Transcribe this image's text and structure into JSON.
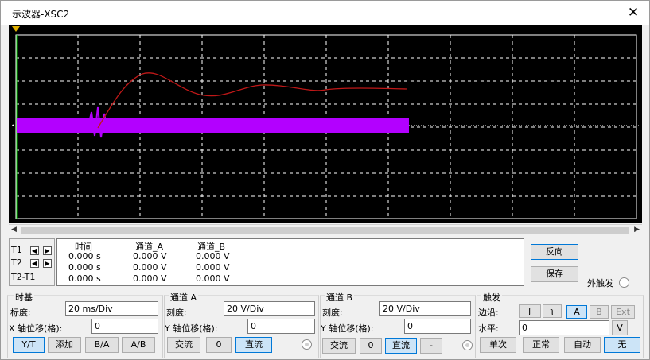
{
  "window": {
    "title": "示波器-XSC2",
    "close_glyph": "✕"
  },
  "colors": {
    "screen_bg": "#000000",
    "grid": "#ffffff",
    "trace_a": "#c01818",
    "trace_b": "#b300ff"
  },
  "cursors": {
    "t1": "T1",
    "t2": "T2",
    "t2t1": "T2-T1",
    "left_glyph": "◀",
    "right_glyph": "▶"
  },
  "readout": {
    "headers": {
      "time": "时间",
      "chan_a": "通道_A",
      "chan_b": "通道_B"
    },
    "rows": [
      {
        "time": "0.000 s",
        "a": "0.000 V",
        "b": "0.000 V"
      },
      {
        "time": "0.000 s",
        "a": "0.000 V",
        "b": "0.000 V"
      },
      {
        "time": "0.000 s",
        "a": "0.000 V",
        "b": "0.000 V"
      }
    ]
  },
  "side_buttons": {
    "reverse": "反向",
    "save": "保存",
    "ext_trigger": "外触发"
  },
  "timebase": {
    "title": "时基",
    "scale_label": "标度:",
    "scale_value": "20 ms/Div",
    "xpos_label": "X 轴位移(格):",
    "xpos_value": "0",
    "buttons": [
      "Y/T",
      "添加",
      "B/A",
      "A/B"
    ]
  },
  "channel_a": {
    "title": "通道 A",
    "scale_label": "刻度:",
    "scale_value": "20  V/Div",
    "ypos_label": "Y 轴位移(格):",
    "ypos_value": "0",
    "buttons": [
      "交流",
      "0",
      "直流"
    ]
  },
  "channel_b": {
    "title": "通道 B",
    "scale_label": "刻度:",
    "scale_value": "20  V/Div",
    "ypos_label": "Y 轴位移(格):",
    "ypos_value": "0",
    "buttons": [
      "交流",
      "0",
      "直流",
      "-"
    ]
  },
  "trigger": {
    "title": "触发",
    "edge_label": "边沿:",
    "level_label": "水平:",
    "level_value": "0",
    "level_unit": "V",
    "edge_rise_glyph": "ʃ",
    "edge_fall_glyph": "ʅ",
    "source_buttons": [
      "A",
      "B",
      "Ext"
    ],
    "mode_buttons": [
      "单次",
      "正常",
      "自动",
      "无"
    ]
  }
}
